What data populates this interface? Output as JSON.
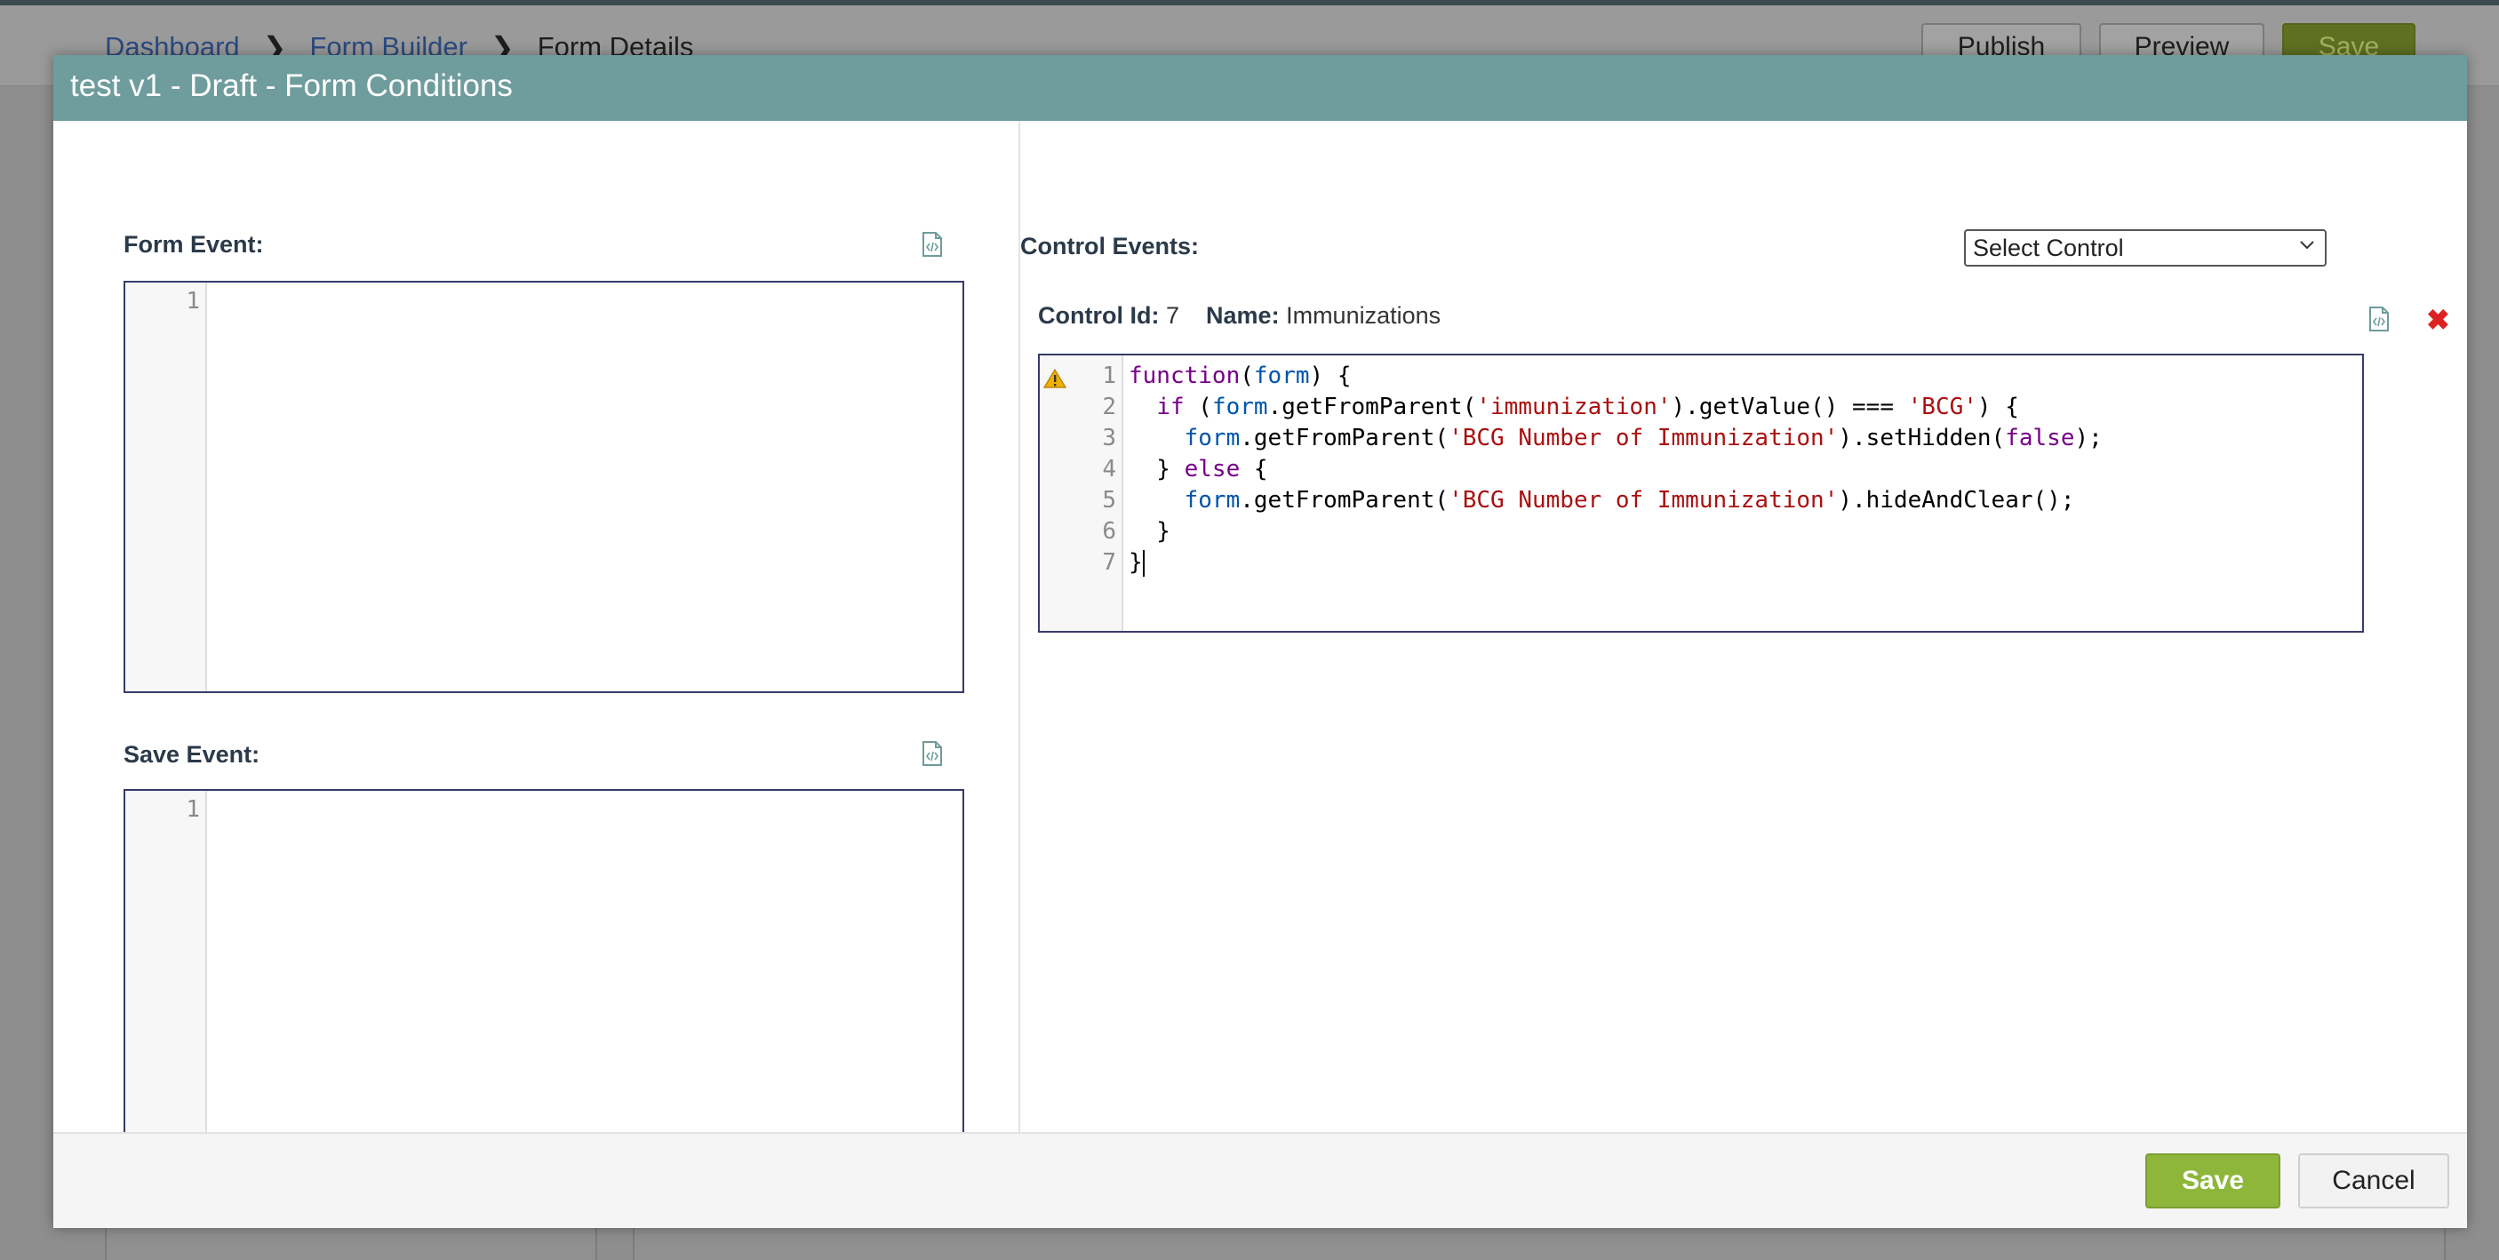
{
  "background": {
    "breadcrumb": [
      {
        "label": "Dashboard"
      },
      {
        "label": "Form Builder"
      },
      {
        "label": "Form Details"
      }
    ],
    "buttons": {
      "publish": "Publish",
      "preview": "Preview",
      "save": "Save"
    }
  },
  "modal": {
    "title": "test v1 - Draft - Form Conditions",
    "form_event": {
      "label": "Form Event:",
      "line_numbers": [
        "1"
      ]
    },
    "save_event": {
      "label": "Save Event:",
      "line_numbers": [
        "1"
      ]
    },
    "control_events": {
      "label": "Control Events:",
      "select": {
        "selected": "Select Control"
      },
      "control_id_label": "Control Id:",
      "control_id": "7",
      "name_label": "Name:",
      "name": "Immunizations",
      "line_numbers": [
        "1",
        "2",
        "3",
        "4",
        "5",
        "6",
        "7"
      ],
      "code_lines": [
        "function(form) {",
        "  if (form.getFromParent('immunization').getValue() === 'BCG') {",
        "    form.getFromParent('BCG Number of Immunization').setHidden(false);",
        "  } else {",
        "    form.getFromParent('BCG Number of Immunization').hideAndClear();",
        "  }",
        "}"
      ]
    },
    "footer": {
      "save": "Save",
      "cancel": "Cancel"
    }
  },
  "colors": {
    "header_teal": "#6f9c9c",
    "save_green": "#8db63a",
    "editor_border": "#373b69",
    "delete_red": "#dd2222"
  }
}
